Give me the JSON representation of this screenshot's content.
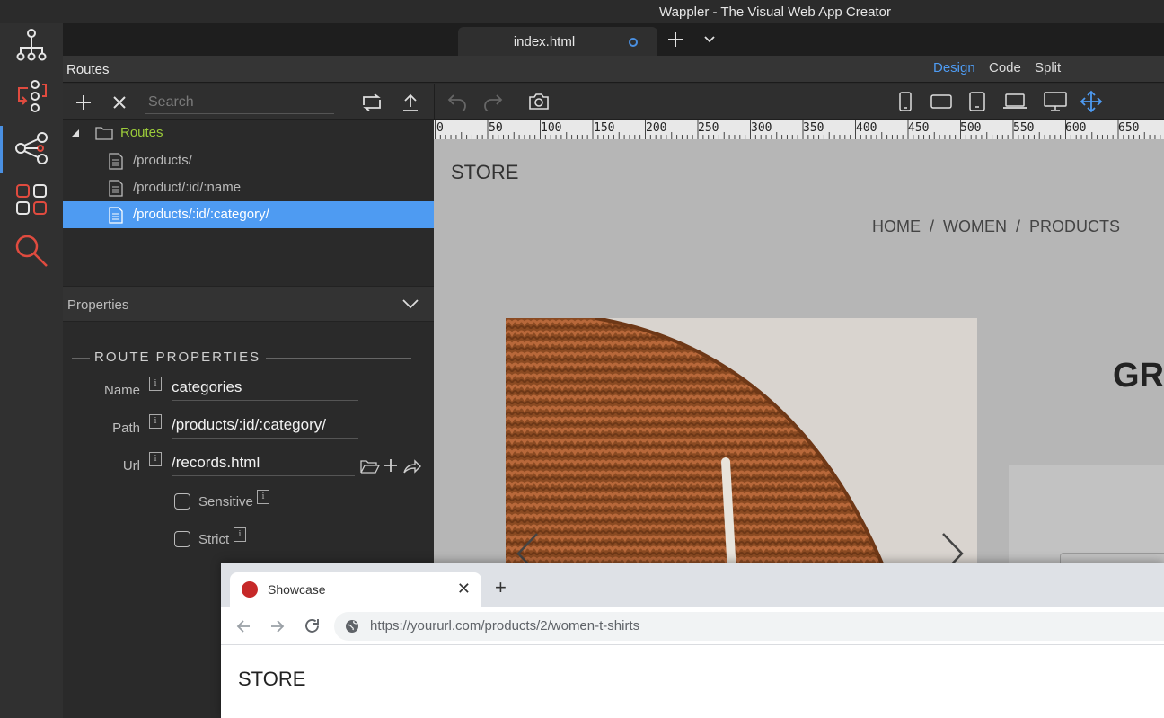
{
  "window": {
    "title": "Wappler - The Visual Web App Creator"
  },
  "tabs": {
    "document": "index.html"
  },
  "header": {
    "panel_title": "Routes",
    "modes": [
      "Design",
      "Code",
      "Split"
    ],
    "active_mode": "Design"
  },
  "routes_panel": {
    "search_placeholder": "Search",
    "root_label": "Routes",
    "items": [
      "/products/",
      "/product/:id/:name",
      "/products/:id/:category/"
    ],
    "selected_index": 2
  },
  "properties": {
    "header": "Properties",
    "section_title": "ROUTE PROPERTIES",
    "name_label": "Name",
    "name_value": "categories",
    "path_label": "Path",
    "path_value": "/products/:id/:category/",
    "url_label": "Url",
    "url_value": "/records.html",
    "sensitive_label": "Sensitive",
    "strict_label": "Strict",
    "info_glyph": "i"
  },
  "ruler": {
    "labels": [
      "0",
      "50",
      "100",
      "150",
      "200",
      "250",
      "300",
      "350",
      "400",
      "450",
      "500",
      "550",
      "600",
      "650"
    ]
  },
  "canvas": {
    "store_label": "STORE",
    "breadcrumb": [
      "HOME",
      "WOMEN",
      "PRODUCTS"
    ],
    "breadcrumb_sep": "/",
    "hero_heading": "GRE"
  },
  "browser": {
    "tab_title": "Showcase",
    "url_host": "https://yoururl.com",
    "url_path": "/products/2/women-t-shirts",
    "store_label": "STORE"
  },
  "colors": {
    "accent": "#4e9bf2",
    "route_root": "#9ccc3a",
    "rail_icons": "#e04b3f"
  }
}
